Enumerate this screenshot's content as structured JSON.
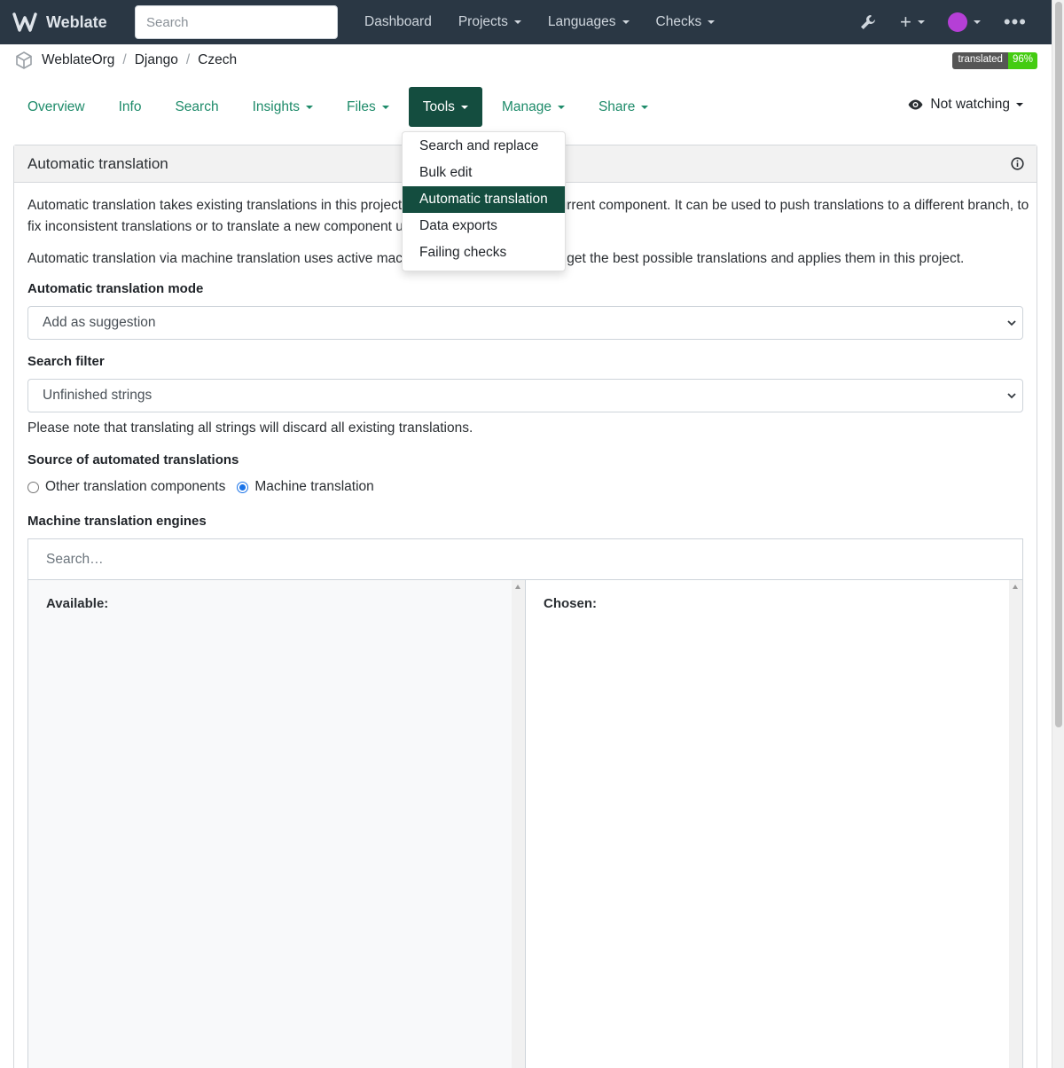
{
  "navbar": {
    "brand": "Weblate",
    "search_placeholder": "Search",
    "links": [
      {
        "label": "Dashboard",
        "dropdown": false
      },
      {
        "label": "Projects",
        "dropdown": true
      },
      {
        "label": "Languages",
        "dropdown": true
      },
      {
        "label": "Checks",
        "dropdown": true
      }
    ]
  },
  "breadcrumb": [
    "WeblateOrg",
    "Django",
    "Czech"
  ],
  "badge": {
    "label": "translated",
    "value": "96%"
  },
  "tabs": [
    {
      "label": "Overview"
    },
    {
      "label": "Info"
    },
    {
      "label": "Search"
    },
    {
      "label": "Insights"
    },
    {
      "label": "Files"
    },
    {
      "label": "Tools"
    },
    {
      "label": "Manage"
    },
    {
      "label": "Share"
    }
  ],
  "watch": {
    "label": "Not watching"
  },
  "tools_menu": [
    "Search and replace",
    "Bulk edit",
    "Automatic translation",
    "Data exports",
    "Failing checks"
  ],
  "panel": {
    "title": "Automatic translation",
    "para1_line1": "Automatic translation takes existing translations in this project and applies them to the current component. It can be used to push translations to a different branch, to",
    "para1_line2": "fix inconsistent translations or to translate a new component using translation memory.",
    "para2": "Automatic translation via machine translation uses active machine translation engines to get the best possible translations and applies them in this project.",
    "mode_label": "Automatic translation mode",
    "mode_value": "Add as suggestion",
    "filter_label": "Search filter",
    "filter_value": "Unfinished strings",
    "filter_note": "Please note that translating all strings will discard all existing translations.",
    "source_label": "Source of automated translations",
    "source_options": [
      "Other translation components",
      "Machine translation"
    ],
    "engines_label": "Machine translation engines",
    "engines_search": "Search…",
    "available_label": "Available:",
    "chosen_label": "Chosen:"
  },
  "colors": {
    "navbar": "#2a3744",
    "accent": "#1e8b6a",
    "active_tab": "#144d3f",
    "badge_ok": "#44cc11"
  }
}
